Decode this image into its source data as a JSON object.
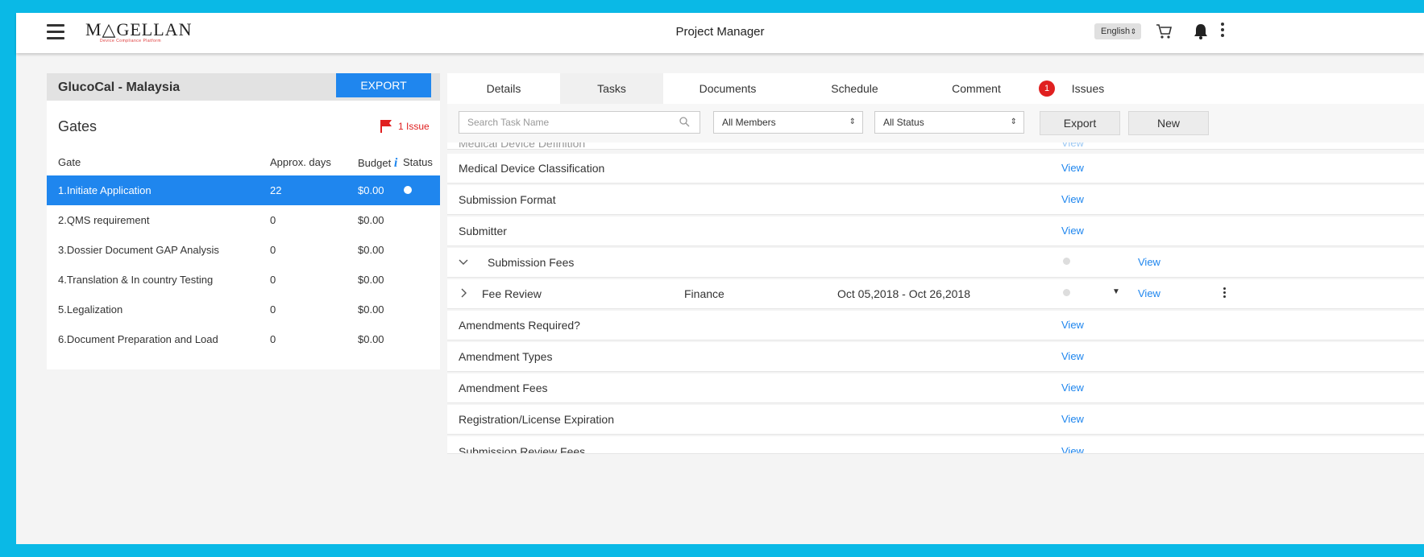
{
  "app": {
    "logo": "M△GELLAN",
    "logo_tagline": "Device Compliance Platform",
    "title": "Project Manager",
    "language": "English"
  },
  "project": {
    "title": "GlucoCal - Malaysia",
    "export_label": "EXPORT",
    "gates_title": "Gates",
    "issue_count_label": "1 Issue",
    "columns": {
      "gate": "Gate",
      "days": "Approx. days",
      "budget": "Budget",
      "status": "Status"
    },
    "gates": [
      {
        "name": "1.Initiate Application",
        "days": "22",
        "budget": "$0.00",
        "selected": true
      },
      {
        "name": "2.QMS requirement",
        "days": "0",
        "budget": "$0.00"
      },
      {
        "name": "3.Dossier Document GAP Analysis",
        "days": "0",
        "budget": "$0.00"
      },
      {
        "name": "4.Translation & In country Testing",
        "days": "0",
        "budget": "$0.00"
      },
      {
        "name": "5.Legalization",
        "days": "0",
        "budget": "$0.00"
      },
      {
        "name": "6.Document Preparation and Load",
        "days": "0",
        "budget": "$0.00"
      }
    ]
  },
  "tabs": [
    "Details",
    "Tasks",
    "Documents",
    "Schedule",
    "Comment",
    "Issues"
  ],
  "issues_badge": "1",
  "filters": {
    "search_placeholder": "Search Task Name",
    "members": "All Members",
    "status": "All Status",
    "export_label": "Export",
    "new_label": "New"
  },
  "tasks": {
    "view_label": "View",
    "rows": [
      {
        "name": "Medical Device Definition"
      },
      {
        "name": "Medical Device Classification"
      },
      {
        "name": "Submission Format"
      },
      {
        "name": "Submitter"
      },
      {
        "name": "Submission Fees"
      },
      {
        "name": "Fee Review",
        "assignee": "Finance",
        "dates": "Oct 05,2018 - Oct 26,2018"
      },
      {
        "name": "Amendments Required?"
      },
      {
        "name": "Amendment Types"
      },
      {
        "name": "Amendment Fees"
      },
      {
        "name": "Registration/License Expiration"
      },
      {
        "name": "Submission Review Fees"
      }
    ]
  },
  "colors": {
    "accent": "#1f86ee",
    "alert": "#e02020",
    "frame": "#0ab9e6"
  }
}
